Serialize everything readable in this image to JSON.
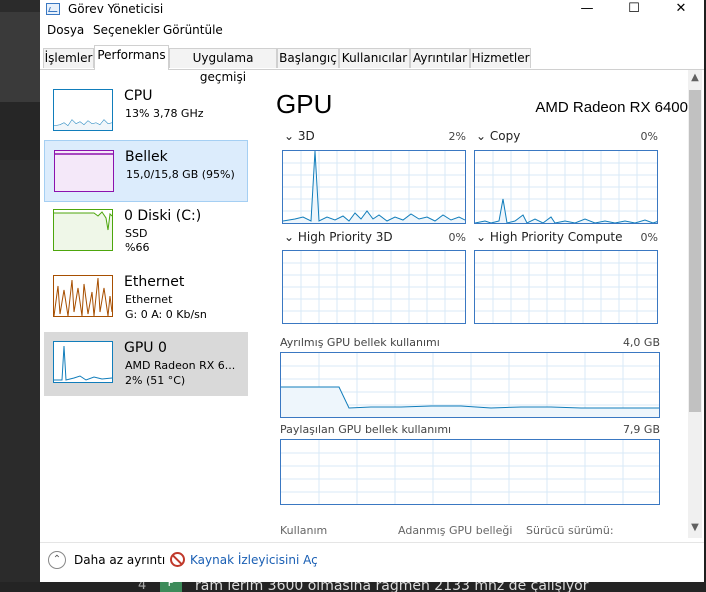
{
  "window": {
    "title": "Görev Yöneticisi",
    "controls": [
      "—",
      "☐",
      "✕"
    ]
  },
  "menu": [
    "Dosya",
    "Seçenekler",
    "Görüntüle"
  ],
  "tabs": [
    "İşlemler",
    "Performans",
    "Uygulama geçmişi",
    "Başlangıç",
    "Kullanıcılar",
    "Ayrıntılar",
    "Hizmetler"
  ],
  "active_tab": "Performans",
  "sidebar": {
    "items": [
      {
        "name": "CPU",
        "line1": "13%  3,78 GHz",
        "line2": "",
        "line3": ""
      },
      {
        "name": "Bellek",
        "line1": "15,0/15,8 GB (95%)",
        "line2": "",
        "line3": ""
      },
      {
        "name": "0 Diski (C:)",
        "line1": "SSD",
        "line2": "%66",
        "line3": ""
      },
      {
        "name": "Ethernet",
        "line1": "Ethernet",
        "line2": "G: 0  A: 0 Kb/sn",
        "line3": ""
      },
      {
        "name": "GPU 0",
        "line1": "AMD Radeon RX 6...",
        "line2": "2%  (51 °C)",
        "line3": ""
      }
    ]
  },
  "main": {
    "title": "GPU",
    "model": "AMD Radeon RX 6400",
    "engines": [
      {
        "label": "3D",
        "percent": "2%",
        "expand_icon": "chevron-down"
      },
      {
        "label": "Copy",
        "percent": "0%",
        "expand_icon": "chevron-down"
      },
      {
        "label": "High Priority 3D",
        "percent": "0%",
        "expand_icon": "chevron-down"
      },
      {
        "label": "High Priority Compute",
        "percent": "0%",
        "expand_icon": "chevron-down"
      }
    ],
    "dedicated": {
      "label": "Ayrılmış GPU bellek kullanımı",
      "max": "4,0 GB"
    },
    "shared": {
      "label": "Paylaşılan GPU bellek kullanımı",
      "max": "7,9 GB"
    },
    "stats": [
      "Kullanım",
      "Adanmış GPU belleği",
      "Sürücü sürümü:"
    ]
  },
  "footer": {
    "fewer_details": "Daha az ayrıntı",
    "resource_monitor": "Kaynak İzleyicisini Aç"
  },
  "background": {
    "text": "ram lerim 3600 olmasına rağmen 2133 mhz de çalışıyor",
    "num": "4",
    "avatar": "P"
  },
  "colors": {
    "cpu": "#117dbb",
    "memory": "#8b12ae",
    "disk": "#4da60c",
    "ethernet": "#a74f01",
    "gpu": "#117dbb",
    "selected_light": "#dcecfc",
    "selected_gray": "#d9d9d9",
    "link": "#1a5fb4"
  }
}
